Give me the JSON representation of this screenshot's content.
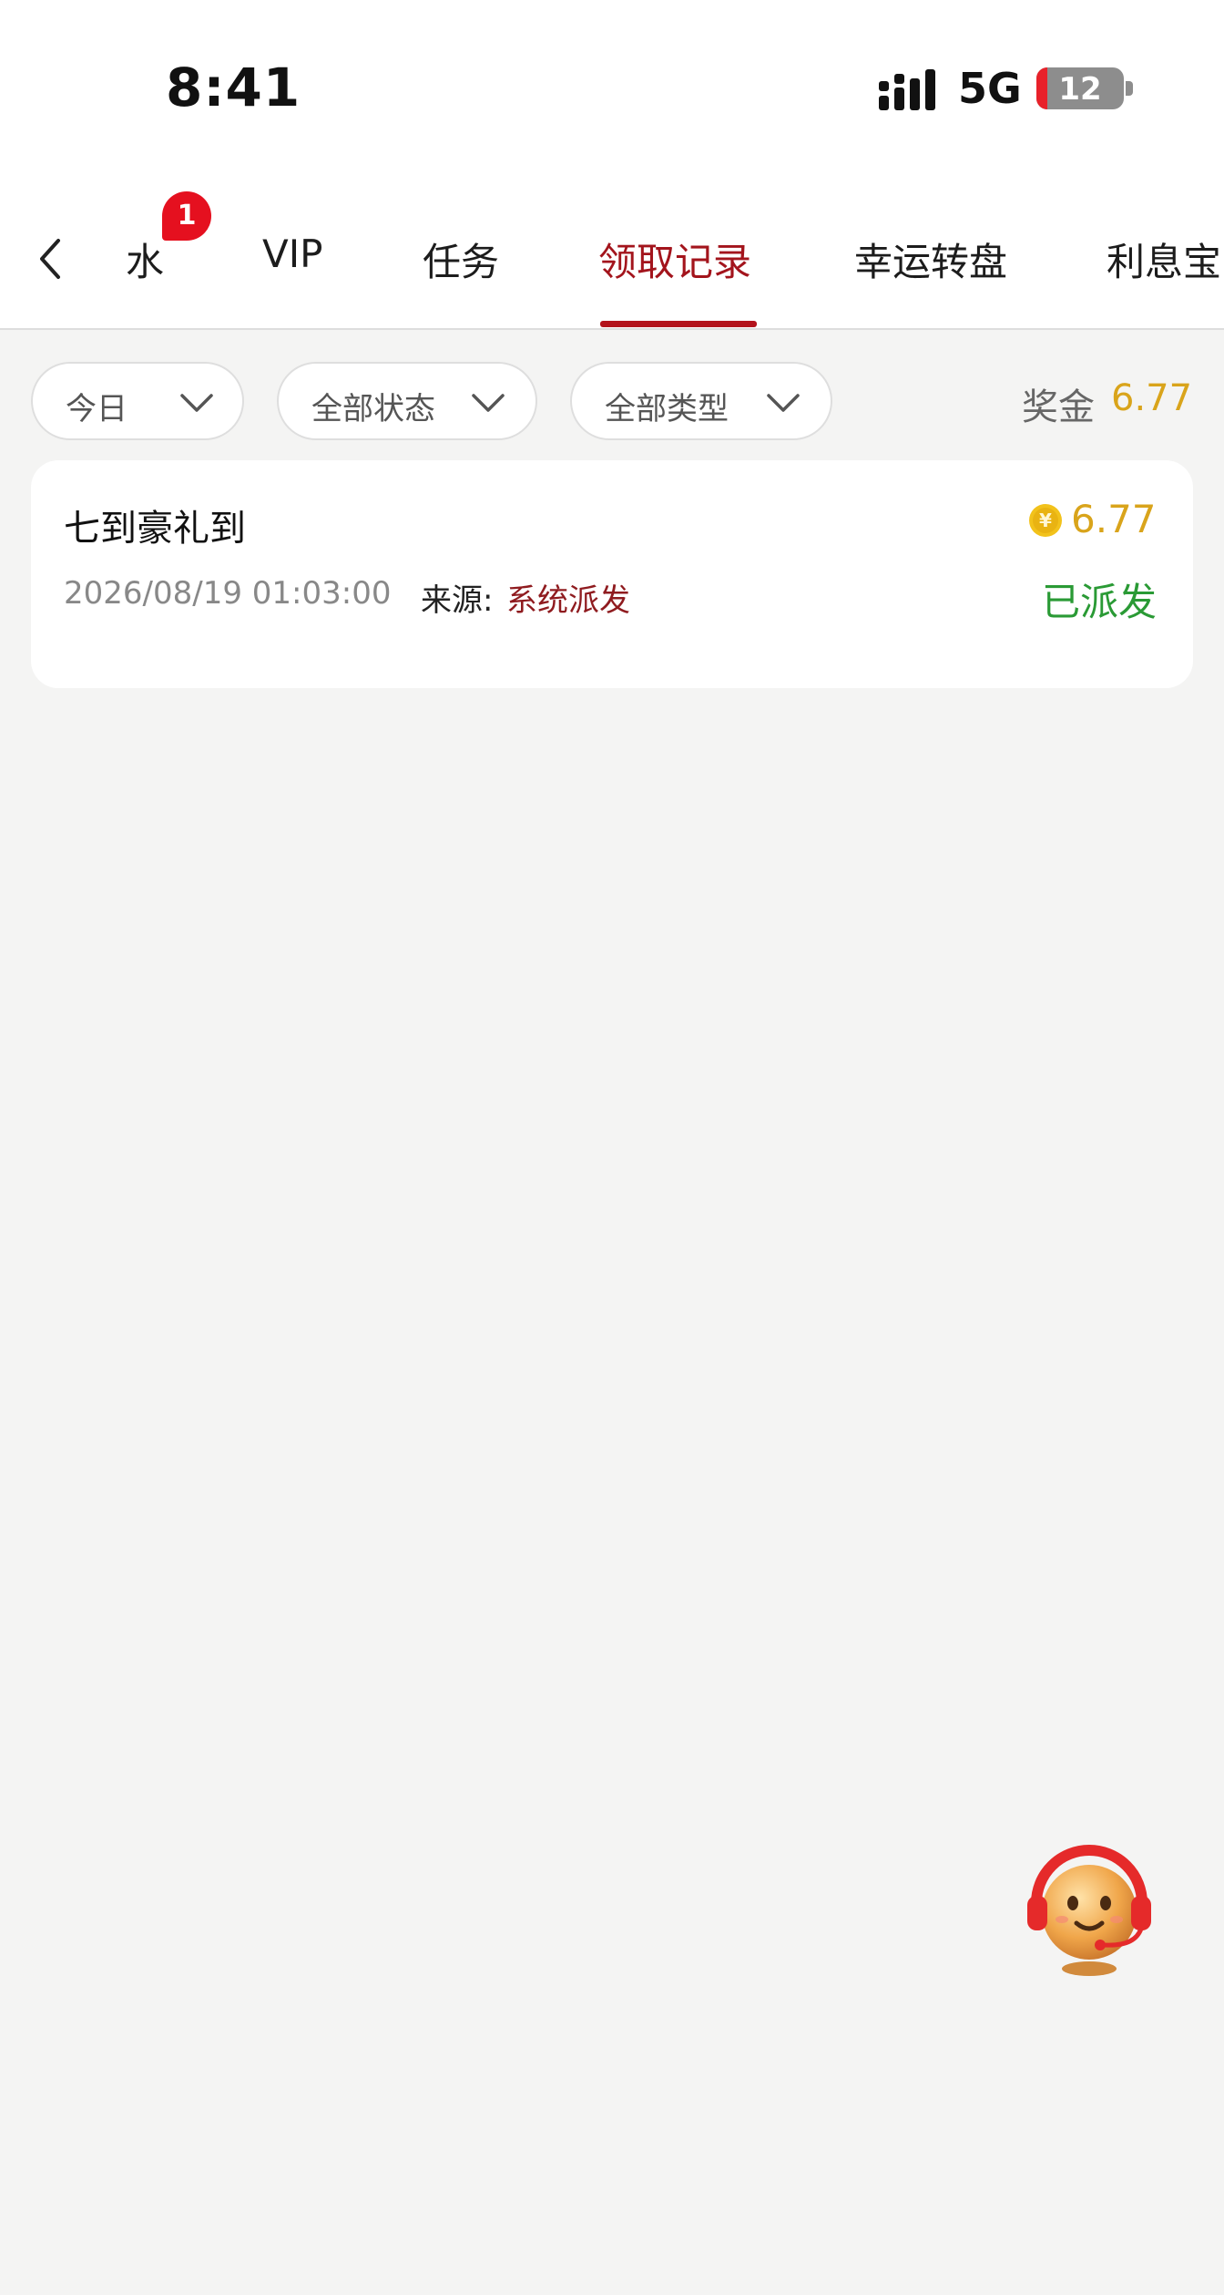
{
  "status_bar": {
    "time": "8:41",
    "network": "5G",
    "battery_level": "12",
    "battery_fraction": 0.12,
    "signal_icon": "signal-bars-icon"
  },
  "tabs": [
    {
      "label": "水",
      "badge": "1"
    },
    {
      "label": "VIP"
    },
    {
      "label": "任务"
    },
    {
      "label": "领取记录",
      "active": true
    },
    {
      "label": "幸运转盘"
    },
    {
      "label": "利息宝"
    }
  ],
  "filters": {
    "date": "今日",
    "status": "全部状态",
    "type": "全部类型"
  },
  "bonus": {
    "label": "奖金",
    "value": "6.77"
  },
  "records": [
    {
      "title": "七到豪礼到",
      "amount": "6.77",
      "time": "2026/08/19 01:03:00",
      "source_label": "来源:",
      "source": "系统派发",
      "status": "已派发"
    }
  ],
  "colors": {
    "accent": "#a3141c",
    "gold": "#d9a41b",
    "success": "#2a9a35",
    "badge": "#e5101f",
    "background": "#f4f4f3"
  },
  "icons": {
    "back": "back-arrow-icon",
    "chevron": "chevron-down-icon",
    "coin": "coin-icon",
    "support": "customer-service-avatar-icon"
  }
}
